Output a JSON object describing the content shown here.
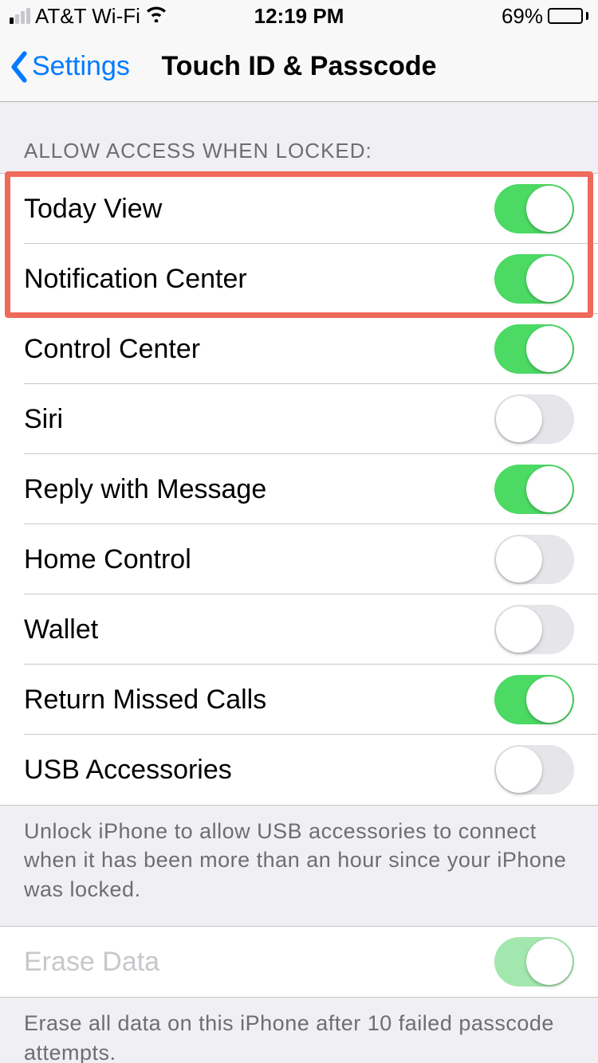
{
  "status_bar": {
    "carrier": "AT&T Wi-Fi",
    "time": "12:19 PM",
    "battery_pct": "69%"
  },
  "nav": {
    "back_label": "Settings",
    "title": "Touch ID & Passcode"
  },
  "section_header": "ALLOW ACCESS WHEN LOCKED:",
  "rows": {
    "today_view": {
      "label": "Today View",
      "on": true
    },
    "notification_center": {
      "label": "Notification Center",
      "on": true
    },
    "control_center": {
      "label": "Control Center",
      "on": true
    },
    "siri": {
      "label": "Siri",
      "on": false
    },
    "reply_with_message": {
      "label": "Reply with Message",
      "on": true
    },
    "home_control": {
      "label": "Home Control",
      "on": false
    },
    "wallet": {
      "label": "Wallet",
      "on": false
    },
    "return_missed_calls": {
      "label": "Return Missed Calls",
      "on": true
    },
    "usb_accessories": {
      "label": "USB Accessories",
      "on": false
    }
  },
  "usb_footer": "Unlock iPhone to allow USB accessories to connect when it has been more than an hour since your iPhone was locked.",
  "erase": {
    "label": "Erase Data",
    "on": true,
    "faded": true
  },
  "erase_footer": "Erase all data on this iPhone after 10 failed passcode attempts.",
  "colors": {
    "tint": "#007aff",
    "switch_on": "#4cd964",
    "highlight": "#ef6a5a"
  }
}
